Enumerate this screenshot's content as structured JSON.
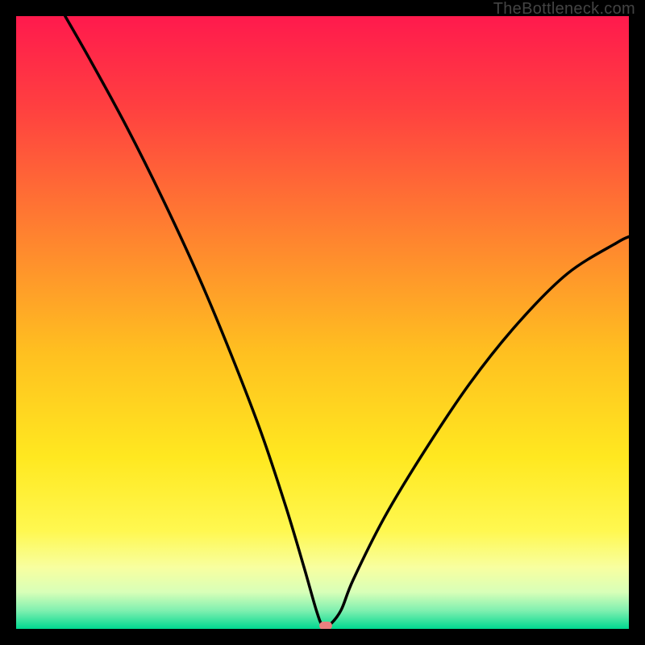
{
  "watermark": "TheBottleneck.com",
  "chart_data": {
    "type": "line",
    "title": "",
    "xlabel": "",
    "ylabel": "",
    "xlim": [
      0,
      100
    ],
    "ylim": [
      0,
      100
    ],
    "grid": false,
    "legend": false,
    "gradient_stops": [
      {
        "pos": 0.0,
        "color": "#ff1a4d"
      },
      {
        "pos": 0.15,
        "color": "#ff4040"
      },
      {
        "pos": 0.35,
        "color": "#ff8030"
      },
      {
        "pos": 0.55,
        "color": "#ffc020"
      },
      {
        "pos": 0.72,
        "color": "#ffe820"
      },
      {
        "pos": 0.84,
        "color": "#fff850"
      },
      {
        "pos": 0.9,
        "color": "#f8ffa0"
      },
      {
        "pos": 0.94,
        "color": "#d8ffb8"
      },
      {
        "pos": 0.97,
        "color": "#80f0b0"
      },
      {
        "pos": 1.0,
        "color": "#00d890"
      }
    ],
    "series": [
      {
        "name": "bottleneck-curve",
        "x": [
          8,
          12,
          18,
          24,
          30,
          35,
          40,
          44,
          47,
          49,
          50,
          51,
          53,
          55,
          60,
          66,
          74,
          82,
          90,
          98,
          100
        ],
        "y": [
          100,
          93,
          82,
          70,
          57,
          45,
          32,
          20,
          10,
          3,
          0.5,
          0.5,
          3,
          8,
          18,
          28,
          40,
          50,
          58,
          63,
          64
        ]
      }
    ],
    "marker": {
      "x": 50.5,
      "y": 0.5,
      "color": "#e98080"
    }
  }
}
